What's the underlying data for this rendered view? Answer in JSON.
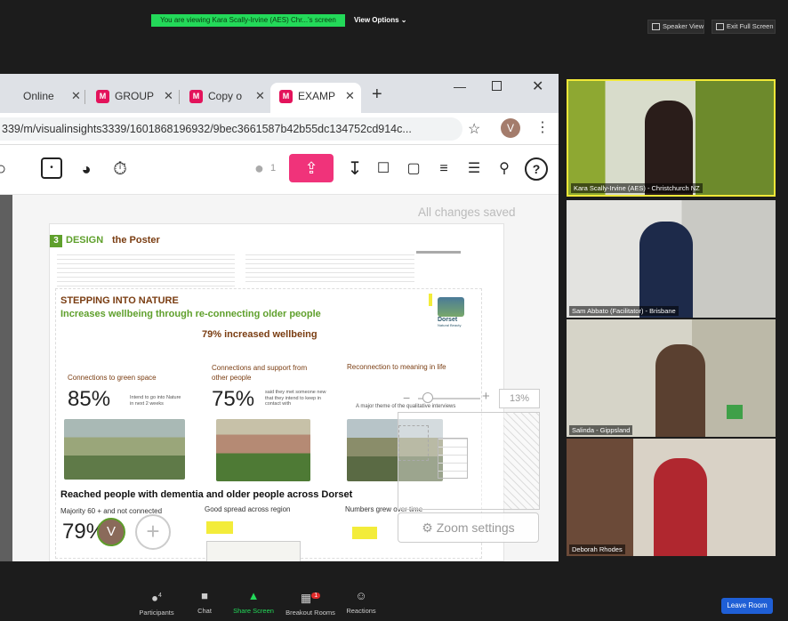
{
  "zoom": {
    "banner": "You are viewing Kara Scally-Irvine (AES)  Chr...'s screen",
    "view_options": "View Options",
    "speaker_view": "Speaker View",
    "exit_full_screen": "Exit Full Screen",
    "participants": [
      {
        "name": "Kara Scally-Irvine (AES) - Christchurch NZ",
        "active": true
      },
      {
        "name": "Sam Abbato (Facilitator) - Brisbane",
        "active": false
      },
      {
        "name": "Salinda - Gippsland",
        "active": false
      },
      {
        "name": "Deborah Rhodes",
        "active": false
      }
    ],
    "bottom": {
      "participants_label": "Participants",
      "participants_count": "4",
      "chat_label": "Chat",
      "share_label": "Share Screen",
      "breakout_label": "Breakout Rooms",
      "breakout_badge": "1",
      "reactions_label": "Reactions",
      "leave_label": "Leave Room"
    }
  },
  "browser": {
    "tabs": [
      {
        "label": "Online",
        "active": false
      },
      {
        "label": "GROUP",
        "active": false
      },
      {
        "label": "Copy o",
        "active": false
      },
      {
        "label": "EXAMP",
        "active": true
      }
    ],
    "url": "339/m/visualinsights3339/1601868196932/9bec3661587b42b55dc134752cd914c...",
    "profile_initial": "V"
  },
  "app": {
    "user_count": "1",
    "saved_status": "All changes saved",
    "zoom_percent": "13%",
    "zoom_settings": "Zoom settings",
    "collaborator_initial": "V"
  },
  "poster": {
    "step_number": "3",
    "step_title_bold": "DESIGN",
    "step_title_rest": "the Poster",
    "title": "STEPPING INTO NATURE",
    "subtitle": "Increases wellbeing through re-connecting older people",
    "headline": "79% increased wellbeing",
    "col1_heading": "Connections to green space",
    "col1_stat": "85%",
    "col1_note": "Intend to go into Nature in next 2 weeks",
    "col2_heading": "Connections and support from other people",
    "col2_stat": "75%",
    "col2_note": "said they met someone new that they intend to keep in contact with",
    "col3_heading": "Reconnection to meaning in life",
    "col3_note": "A major theme of the qualitative interviews",
    "reach_heading": "Reached  people with dementia and older people across Dorset",
    "reach_col1": "Majority 60 + and not connected",
    "reach_col1_stat": "79%",
    "reach_col2": "Good spread across region",
    "reach_col3": "Numbers grew over time",
    "logo_word": "Dorset",
    "logo_sub": "Natural Beauty"
  },
  "colors": {
    "brand_pink": "#f0337a",
    "zoom_green": "#23d959",
    "leave_blue": "#1f5fd6",
    "poster_green": "#5fa02c",
    "poster_brown": "#7a3d12"
  }
}
